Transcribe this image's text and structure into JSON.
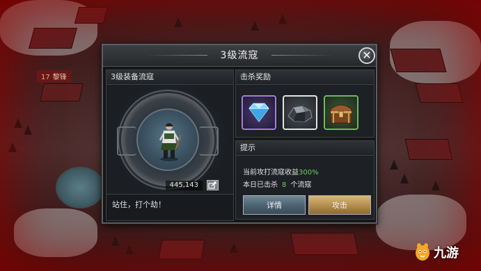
{
  "hud": {
    "level_badge": "17",
    "player_name": "黎锋"
  },
  "dialog": {
    "title": "3级流寇",
    "close_glyph": "✕",
    "left_panel": {
      "header": "3级装备流寇",
      "power": "445,143",
      "flavor_text": "站住，打个劫！"
    },
    "rewards": {
      "header": "击杀奖励",
      "items": [
        {
          "icon": "diamond-icon",
          "rarity_color": "#9f7de0"
        },
        {
          "icon": "iron-ore-icon",
          "rarity_color": "#e4e4e4"
        },
        {
          "icon": "treasure-chest-icon",
          "rarity_color": "#6fb85d"
        }
      ]
    },
    "tips": {
      "header": "提示",
      "line1_prefix": "当前攻打流寇收益",
      "line1_value": "300%",
      "line2_prefix": "本日已击杀",
      "line2_count": "8",
      "line2_suffix": "个流寇"
    },
    "buttons": {
      "detail": "详情",
      "attack": "攻击"
    }
  },
  "watermark": {
    "text": "九游"
  },
  "colors": {
    "highlight_green": "#6fd15b",
    "attack_gold": "#b38c4e",
    "detail_blue": "#4b6170"
  }
}
